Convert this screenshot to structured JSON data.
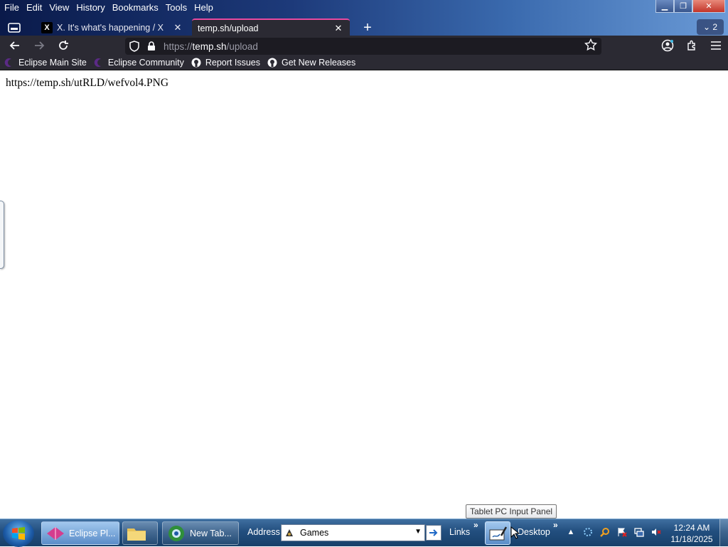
{
  "menubar": {
    "items": [
      "File",
      "Edit",
      "View",
      "History",
      "Bookmarks",
      "Tools",
      "Help"
    ]
  },
  "tabs": [
    {
      "title": "X. It's what's happening / X",
      "favicon": "X",
      "active": false
    },
    {
      "title": "temp.sh/upload",
      "active": true
    }
  ],
  "tab_count": "2",
  "url": {
    "scheme": "https://",
    "host": "temp.sh",
    "path": "/upload"
  },
  "bookmarks": [
    "Eclipse Main Site",
    "Eclipse Community",
    "Report Issues",
    "Get New Releases"
  ],
  "page": {
    "text": "https://temp.sh/utRLD/wefvol4.PNG"
  },
  "taskbar": {
    "buttons": [
      {
        "label": "Eclipse Pl..."
      },
      {
        "label": "New Tab..."
      }
    ],
    "address_label": "Address",
    "address_value": "Games",
    "links_label": "Links",
    "desktop_label": "Desktop",
    "time": "12:24 AM",
    "date": "11/18/2025"
  },
  "tooltip": "Tablet PC Input Panel",
  "colors": {
    "accent": "#e84aa0",
    "toolbar": "#2b2a33"
  }
}
